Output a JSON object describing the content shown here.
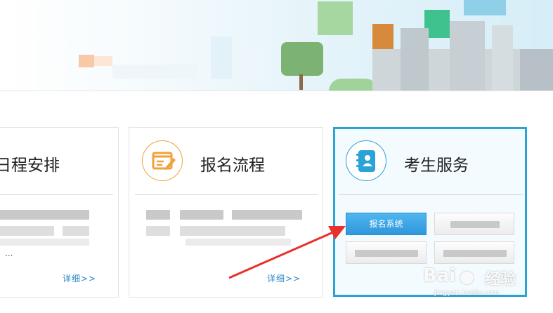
{
  "cards": [
    {
      "title": "日程安排",
      "more": "详细>>",
      "ellipsis": "..."
    },
    {
      "title": "报名流程",
      "more": "详细>>"
    },
    {
      "title": "考生服务"
    }
  ],
  "services": {
    "primary_label": "报名系统"
  },
  "watermark": {
    "brand": "Bai",
    "brand_cn": "经验",
    "url": "jingyan.baidu.com"
  },
  "colors": {
    "accent": "#2aa3d6",
    "primary_button": "#3aa7e6",
    "arrow": "#e8312a",
    "icon_orange": "#f0a23a",
    "icon_blue": "#2aa3d6"
  }
}
